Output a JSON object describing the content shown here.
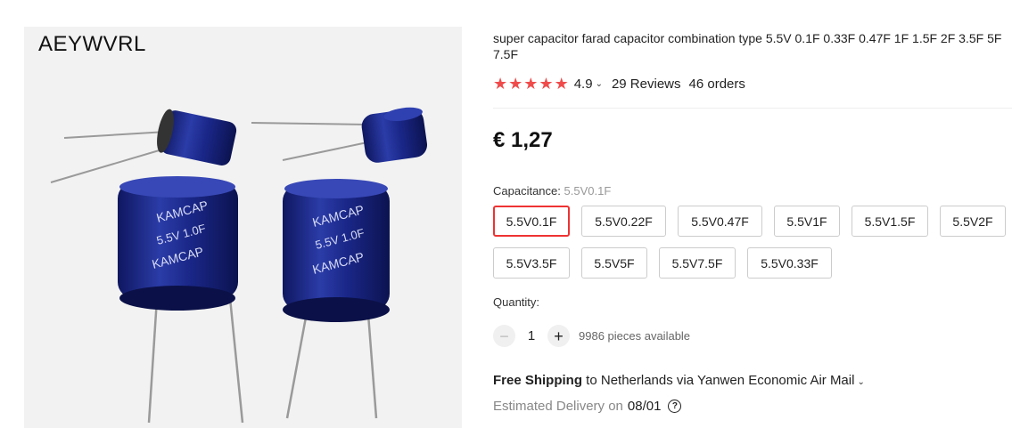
{
  "image": {
    "alt": "super capacitor farad capacitor product photo",
    "watermark": "AEYWVRL"
  },
  "product": {
    "title": "super capacitor farad capacitor combination type 5.5V 0.1F 0.33F 0.47F 1F 1.5F 2F 3.5F 5F 7.5F",
    "rating": "4.9",
    "stars": 5,
    "reviews": "29 Reviews",
    "orders": "46 orders",
    "price": "€ 1,27"
  },
  "capacitance": {
    "label": "Capacitance:",
    "selected": "5.5V0.1F",
    "options": [
      "5.5V0.1F",
      "5.5V0.22F",
      "5.5V0.47F",
      "5.5V1F",
      "5.5V1.5F",
      "5.5V2F",
      "5.5V3.5F",
      "5.5V5F",
      "5.5V7.5F",
      "5.5V0.33F"
    ]
  },
  "quantity": {
    "label": "Quantity:",
    "value": "1",
    "available": "9986 pieces available"
  },
  "shipping": {
    "free": "Free Shipping",
    "to": " to Netherlands via Yanwen Economic Air Mail",
    "delivery_label": "Estimated Delivery on",
    "delivery_date": "08/01"
  },
  "colors": {
    "star": "#f04b4b",
    "selected_border": "#e33333",
    "capacitor_body": "#1d2a8a"
  }
}
